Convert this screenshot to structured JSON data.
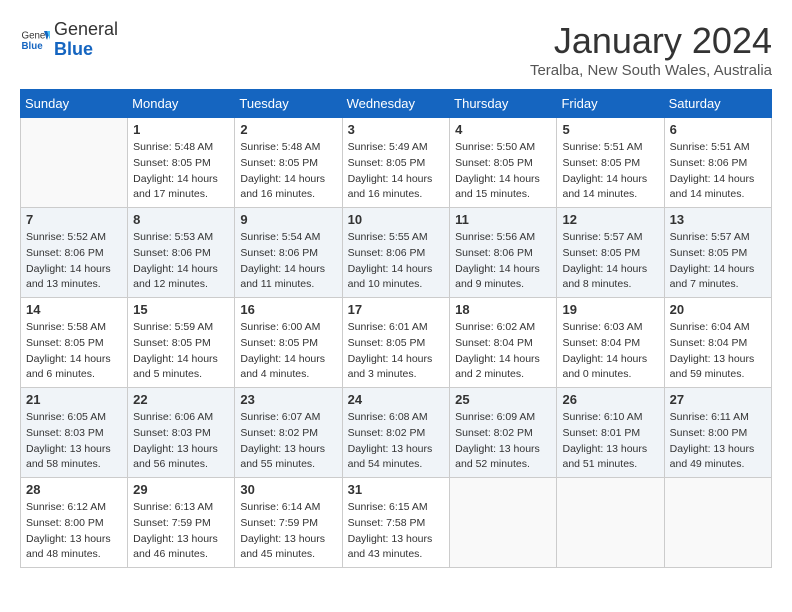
{
  "header": {
    "logo_general": "General",
    "logo_blue": "Blue",
    "month_title": "January 2024",
    "location": "Teralba, New South Wales, Australia"
  },
  "days_of_week": [
    "Sunday",
    "Monday",
    "Tuesday",
    "Wednesday",
    "Thursday",
    "Friday",
    "Saturday"
  ],
  "weeks": [
    [
      {
        "day": "",
        "info": ""
      },
      {
        "day": "1",
        "info": "Sunrise: 5:48 AM\nSunset: 8:05 PM\nDaylight: 14 hours\nand 17 minutes."
      },
      {
        "day": "2",
        "info": "Sunrise: 5:48 AM\nSunset: 8:05 PM\nDaylight: 14 hours\nand 16 minutes."
      },
      {
        "day": "3",
        "info": "Sunrise: 5:49 AM\nSunset: 8:05 PM\nDaylight: 14 hours\nand 16 minutes."
      },
      {
        "day": "4",
        "info": "Sunrise: 5:50 AM\nSunset: 8:05 PM\nDaylight: 14 hours\nand 15 minutes."
      },
      {
        "day": "5",
        "info": "Sunrise: 5:51 AM\nSunset: 8:05 PM\nDaylight: 14 hours\nand 14 minutes."
      },
      {
        "day": "6",
        "info": "Sunrise: 5:51 AM\nSunset: 8:06 PM\nDaylight: 14 hours\nand 14 minutes."
      }
    ],
    [
      {
        "day": "7",
        "info": "Sunrise: 5:52 AM\nSunset: 8:06 PM\nDaylight: 14 hours\nand 13 minutes."
      },
      {
        "day": "8",
        "info": "Sunrise: 5:53 AM\nSunset: 8:06 PM\nDaylight: 14 hours\nand 12 minutes."
      },
      {
        "day": "9",
        "info": "Sunrise: 5:54 AM\nSunset: 8:06 PM\nDaylight: 14 hours\nand 11 minutes."
      },
      {
        "day": "10",
        "info": "Sunrise: 5:55 AM\nSunset: 8:06 PM\nDaylight: 14 hours\nand 10 minutes."
      },
      {
        "day": "11",
        "info": "Sunrise: 5:56 AM\nSunset: 8:06 PM\nDaylight: 14 hours\nand 9 minutes."
      },
      {
        "day": "12",
        "info": "Sunrise: 5:57 AM\nSunset: 8:05 PM\nDaylight: 14 hours\nand 8 minutes."
      },
      {
        "day": "13",
        "info": "Sunrise: 5:57 AM\nSunset: 8:05 PM\nDaylight: 14 hours\nand 7 minutes."
      }
    ],
    [
      {
        "day": "14",
        "info": "Sunrise: 5:58 AM\nSunset: 8:05 PM\nDaylight: 14 hours\nand 6 minutes."
      },
      {
        "day": "15",
        "info": "Sunrise: 5:59 AM\nSunset: 8:05 PM\nDaylight: 14 hours\nand 5 minutes."
      },
      {
        "day": "16",
        "info": "Sunrise: 6:00 AM\nSunset: 8:05 PM\nDaylight: 14 hours\nand 4 minutes."
      },
      {
        "day": "17",
        "info": "Sunrise: 6:01 AM\nSunset: 8:05 PM\nDaylight: 14 hours\nand 3 minutes."
      },
      {
        "day": "18",
        "info": "Sunrise: 6:02 AM\nSunset: 8:04 PM\nDaylight: 14 hours\nand 2 minutes."
      },
      {
        "day": "19",
        "info": "Sunrise: 6:03 AM\nSunset: 8:04 PM\nDaylight: 14 hours\nand 0 minutes."
      },
      {
        "day": "20",
        "info": "Sunrise: 6:04 AM\nSunset: 8:04 PM\nDaylight: 13 hours\nand 59 minutes."
      }
    ],
    [
      {
        "day": "21",
        "info": "Sunrise: 6:05 AM\nSunset: 8:03 PM\nDaylight: 13 hours\nand 58 minutes."
      },
      {
        "day": "22",
        "info": "Sunrise: 6:06 AM\nSunset: 8:03 PM\nDaylight: 13 hours\nand 56 minutes."
      },
      {
        "day": "23",
        "info": "Sunrise: 6:07 AM\nSunset: 8:02 PM\nDaylight: 13 hours\nand 55 minutes."
      },
      {
        "day": "24",
        "info": "Sunrise: 6:08 AM\nSunset: 8:02 PM\nDaylight: 13 hours\nand 54 minutes."
      },
      {
        "day": "25",
        "info": "Sunrise: 6:09 AM\nSunset: 8:02 PM\nDaylight: 13 hours\nand 52 minutes."
      },
      {
        "day": "26",
        "info": "Sunrise: 6:10 AM\nSunset: 8:01 PM\nDaylight: 13 hours\nand 51 minutes."
      },
      {
        "day": "27",
        "info": "Sunrise: 6:11 AM\nSunset: 8:00 PM\nDaylight: 13 hours\nand 49 minutes."
      }
    ],
    [
      {
        "day": "28",
        "info": "Sunrise: 6:12 AM\nSunset: 8:00 PM\nDaylight: 13 hours\nand 48 minutes."
      },
      {
        "day": "29",
        "info": "Sunrise: 6:13 AM\nSunset: 7:59 PM\nDaylight: 13 hours\nand 46 minutes."
      },
      {
        "day": "30",
        "info": "Sunrise: 6:14 AM\nSunset: 7:59 PM\nDaylight: 13 hours\nand 45 minutes."
      },
      {
        "day": "31",
        "info": "Sunrise: 6:15 AM\nSunset: 7:58 PM\nDaylight: 13 hours\nand 43 minutes."
      },
      {
        "day": "",
        "info": ""
      },
      {
        "day": "",
        "info": ""
      },
      {
        "day": "",
        "info": ""
      }
    ]
  ]
}
